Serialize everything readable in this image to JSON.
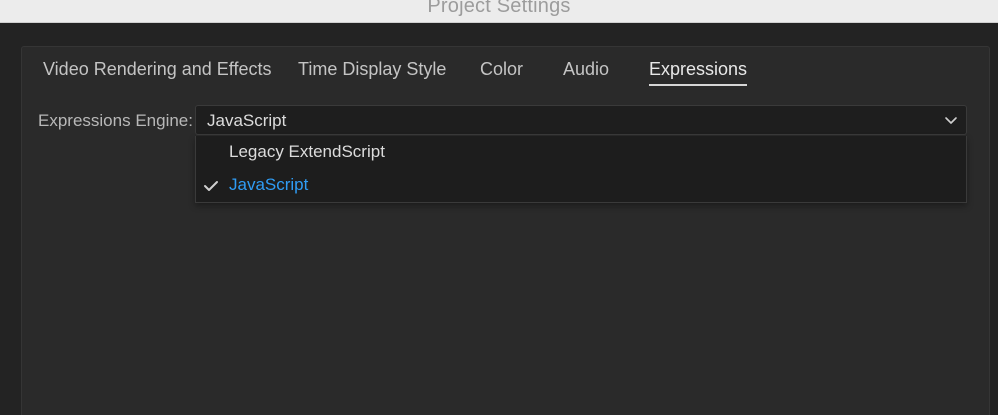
{
  "window": {
    "title": "Project Settings"
  },
  "tabs": [
    {
      "label": "Video Rendering and Effects",
      "active": false
    },
    {
      "label": "Time Display Style",
      "active": false
    },
    {
      "label": "Color",
      "active": false
    },
    {
      "label": "Audio",
      "active": false
    },
    {
      "label": "Expressions",
      "active": true
    }
  ],
  "expressions": {
    "engine_label": "Expressions Engine:",
    "engine_value": "JavaScript",
    "options": [
      {
        "label": "Legacy ExtendScript",
        "selected": false
      },
      {
        "label": "JavaScript",
        "selected": true
      }
    ]
  },
  "icons": {
    "dropdown": "chevron-down-icon",
    "selected": "checkmark-icon"
  },
  "colors": {
    "selected_option": "#2f9cf4",
    "background": "#232323",
    "panel": "#2a2a2a"
  }
}
